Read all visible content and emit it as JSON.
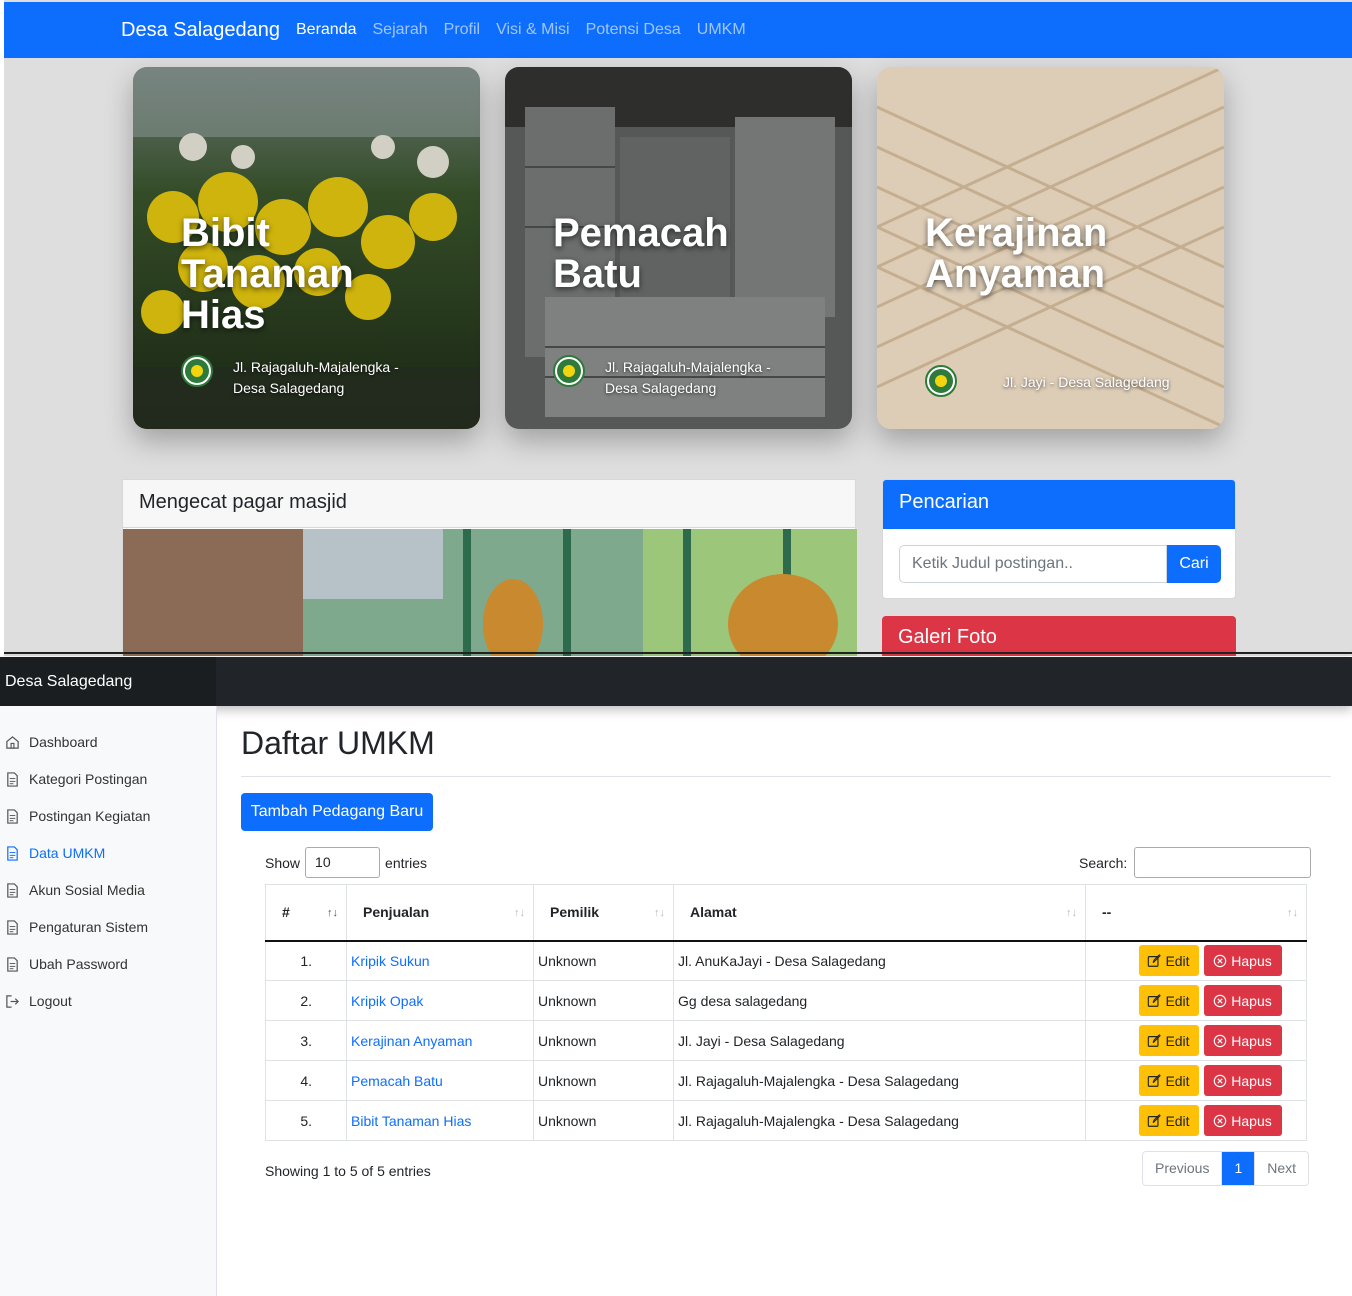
{
  "site": {
    "brand": "Desa Salagedang",
    "nav": [
      "Beranda",
      "Sejarah",
      "Profil",
      "Visi & Misi",
      "Potensi Desa",
      "UMKM"
    ],
    "hero_cards": [
      {
        "title": "Bibit Tanaman Hias",
        "location": "Jl. Rajagaluh-Majalengka - Desa Salagedang"
      },
      {
        "title": "Pemacah Batu",
        "location": "Jl. Rajagaluh-Majalengka - Desa Salagedang"
      },
      {
        "title": "Kerajinan Anyaman",
        "location": "Jl. Jayi - Desa Salagedang"
      }
    ],
    "post_title": "Mengecat pagar masjid",
    "search": {
      "title": "Pencarian",
      "placeholder": "Ketik Judul postingan..",
      "button": "Cari"
    },
    "gallery_title": "Galeri Foto"
  },
  "admin": {
    "brand": "Desa Salagedang",
    "sidebar": [
      "Dashboard",
      "Kategori Postingan",
      "Postingan Kegiatan",
      "Data UMKM",
      "Akun Sosial Media",
      "Pengaturan Sistem",
      "Ubah Password",
      "Logout"
    ],
    "active_item": "Data UMKM",
    "page_title": "Daftar UMKM",
    "add_button": "Tambah Pedagang Baru",
    "show_label": "Show",
    "entries_value": "10",
    "entries_label": "entries",
    "search_label": "Search:",
    "columns": [
      "#",
      "Penjualan",
      "Pemilik",
      "Alamat",
      "--"
    ],
    "rows": [
      {
        "no": "1.",
        "penjualan": "Kripik Sukun",
        "pemilik": "Unknown",
        "alamat": "Jl. AnuKaJayi - Desa Salagedang"
      },
      {
        "no": "2.",
        "penjualan": "Kripik Opak",
        "pemilik": "Unknown",
        "alamat": "Gg desa salagedang"
      },
      {
        "no": "3.",
        "penjualan": "Kerajinan Anyaman",
        "pemilik": "Unknown",
        "alamat": "Jl. Jayi - Desa Salagedang"
      },
      {
        "no": "4.",
        "penjualan": "Pemacah Batu",
        "pemilik": "Unknown",
        "alamat": "Jl. Rajagaluh-Majalengka - Desa Salagedang"
      },
      {
        "no": "5.",
        "penjualan": "Bibit Tanaman Hias",
        "pemilik": "Unknown",
        "alamat": "Jl. Rajagaluh-Majalengka - Desa Salagedang"
      }
    ],
    "edit_label": "Edit",
    "delete_label": "Hapus",
    "info": "Showing 1 to 5 of 5 entries",
    "pagination": {
      "previous": "Previous",
      "current": "1",
      "next": "Next"
    },
    "colors": {
      "primary": "#0d6efd",
      "warning": "#ffc107",
      "danger": "#dc3545",
      "dark": "#212529"
    }
  }
}
